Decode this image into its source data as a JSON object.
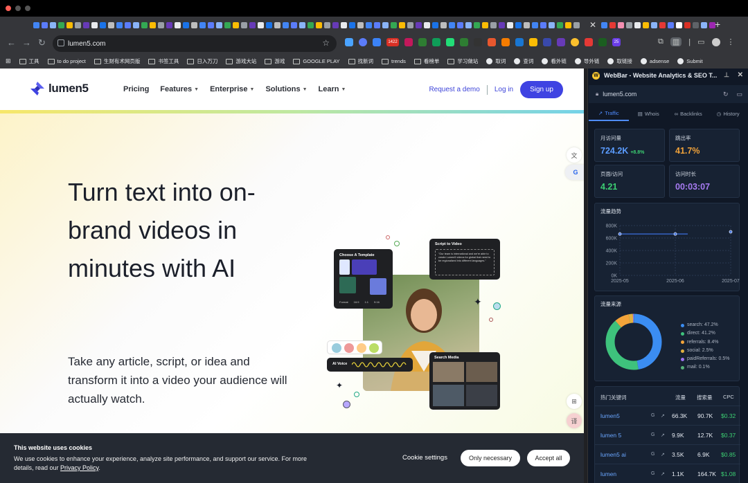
{
  "browser": {
    "url": "lumen5.com",
    "bookmarks": [
      "工具",
      "to do project",
      "生财有术网页版",
      "书签工具",
      "日入万刀",
      "游戏大站",
      "游戏",
      "GOOGLE PLAY",
      "找新词",
      "trends",
      "看榜单",
      "学习做站",
      "取词",
      "查词",
      "看外链",
      "导外链",
      "取链接",
      "adsense",
      "Submit"
    ],
    "badge": "1422",
    "ext_badge": "25"
  },
  "site": {
    "logo_text": "lumen5",
    "nav": {
      "pricing": "Pricing",
      "features": "Features",
      "enterprise": "Enterprise",
      "solutions": "Solutions",
      "learn": "Learn",
      "request_demo": "Request a demo",
      "login": "Log in",
      "signup": "Sign up"
    },
    "hero": {
      "title": "Turn text into on-brand videos in minutes with AI",
      "subtitle": "Take any article, script, or idea and transform it into a video your audience will actually watch."
    },
    "collage": {
      "template_title": "Choose A Template",
      "template_labels": [
        "Format",
        "16:9",
        "1:1",
        "9:16"
      ],
      "script_title": "Script to Video",
      "script_text": "\"Our team is international and we're able to create Lumen5 videos for global that need to be regionalized into different languages.\"",
      "ai_voice": "AI Voice",
      "search_media": "Search Media"
    },
    "cookie": {
      "title": "This website uses cookies",
      "text_before": "We use cookies to enhance your experience, analyze site performance, and support our service. For more details, read our ",
      "policy_link": "Privacy Policy",
      "text_after": ".",
      "settings": "Cookie settings",
      "only_necessary": "Only necessary",
      "accept_all": "Accept all"
    }
  },
  "panel": {
    "title": "WebBar - Website Analytics & SEO T...",
    "domain": "lumen5.com",
    "tabs": [
      "Traffic",
      "Whois",
      "Backlinks",
      "History"
    ],
    "stats": {
      "visits_label": "月访问量",
      "visits_value": "724.2K",
      "visits_change": "+8.8%",
      "bounce_label": "跳出率",
      "bounce_value": "41.7%",
      "pages_label": "页面/访问",
      "pages_value": "4.21",
      "duration_label": "访问时长",
      "duration_value": "00:03:07"
    },
    "colors": {
      "visits": "#5b9cff",
      "bounce": "#f2a33a",
      "pages": "#3ccf72",
      "duration": "#a77bf2"
    },
    "trend_title": "流量趋势",
    "sources_title": "流量来源",
    "keywords": {
      "title": "热门关键词",
      "col_traffic": "流量",
      "col_volume": "搜索量",
      "col_cpc": "CPC",
      "rows": [
        {
          "kw": "lumen5",
          "traffic": "66.3K",
          "volume": "90.7K",
          "cpc": "$0.32"
        },
        {
          "kw": "lumen 5",
          "traffic": "9.9K",
          "volume": "12.7K",
          "cpc": "$0.37"
        },
        {
          "kw": "lumen5 ai",
          "traffic": "3.5K",
          "volume": "6.9K",
          "cpc": "$0.85"
        },
        {
          "kw": "lumen",
          "traffic": "1.1K",
          "volume": "164.7K",
          "cpc": "$1.08"
        }
      ]
    }
  },
  "chart_data": [
    {
      "type": "line",
      "title": "流量趋势",
      "x": [
        "2025-05",
        "2025-06",
        "2025-07"
      ],
      "series": [
        {
          "values": [
            665000,
            665000,
            700000
          ]
        }
      ],
      "y_ticks": [
        "0K",
        "200K",
        "400K",
        "600K",
        "800K"
      ],
      "ylim": [
        0,
        800000
      ],
      "grid": true
    },
    {
      "type": "pie",
      "title": "流量来源",
      "categories": [
        "search",
        "direct",
        "referrals",
        "social",
        "paidReferrals",
        "mail"
      ],
      "values": [
        47.2,
        41.2,
        8.4,
        2.5,
        0.5,
        0.1
      ],
      "labels": [
        "search: 47.2%",
        "direct: 41.2%",
        "referrals: 8.4%",
        "social: 2.5%",
        "paidReferrals: 0.5%",
        "mail: 0.1%"
      ],
      "colors": [
        "#3b8df2",
        "#3ec27c",
        "#f3a43a",
        "#e0b040",
        "#9b72ef",
        "#57b27a"
      ],
      "legend": "right"
    }
  ]
}
